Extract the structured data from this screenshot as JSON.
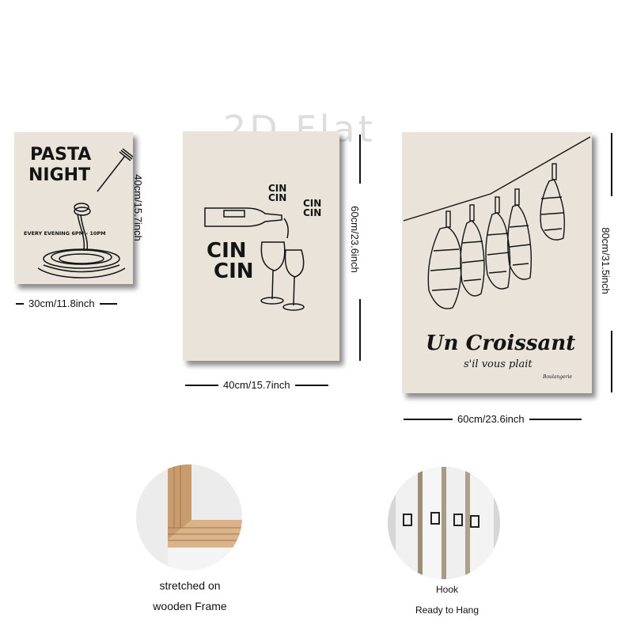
{
  "watermark": "2D Flat",
  "posters": {
    "small": {
      "title_line1": "PASTA",
      "title_line2": "NIGHT",
      "subtitle": "EVERY EVENING  6PM - 10PM",
      "width_label": "30cm/11.8inch",
      "height_label": "40cm/15.7inch"
    },
    "medium": {
      "cin_small_1": "CIN\nCIN",
      "cin_small_2": "CIN\nCIN",
      "cin_big": "CIN\nCIN",
      "width_label": "40cm/15.7inch",
      "height_label": "60cm/23.6inch"
    },
    "large": {
      "title": "Un Croissant",
      "subtitle": "s'il vous plait",
      "signature": "Boulangerie",
      "width_label": "60cm/23.6inch",
      "height_label": "80cm/31.5inch"
    }
  },
  "features": {
    "frame": {
      "line1": "stretched on",
      "line2": "wooden Frame"
    },
    "hook": {
      "line1": "Hook",
      "line2": "Ready to Hang"
    }
  },
  "colors": {
    "canvas": "#e9e3d9",
    "ink": "#141414",
    "wood": "#d9b48a"
  }
}
